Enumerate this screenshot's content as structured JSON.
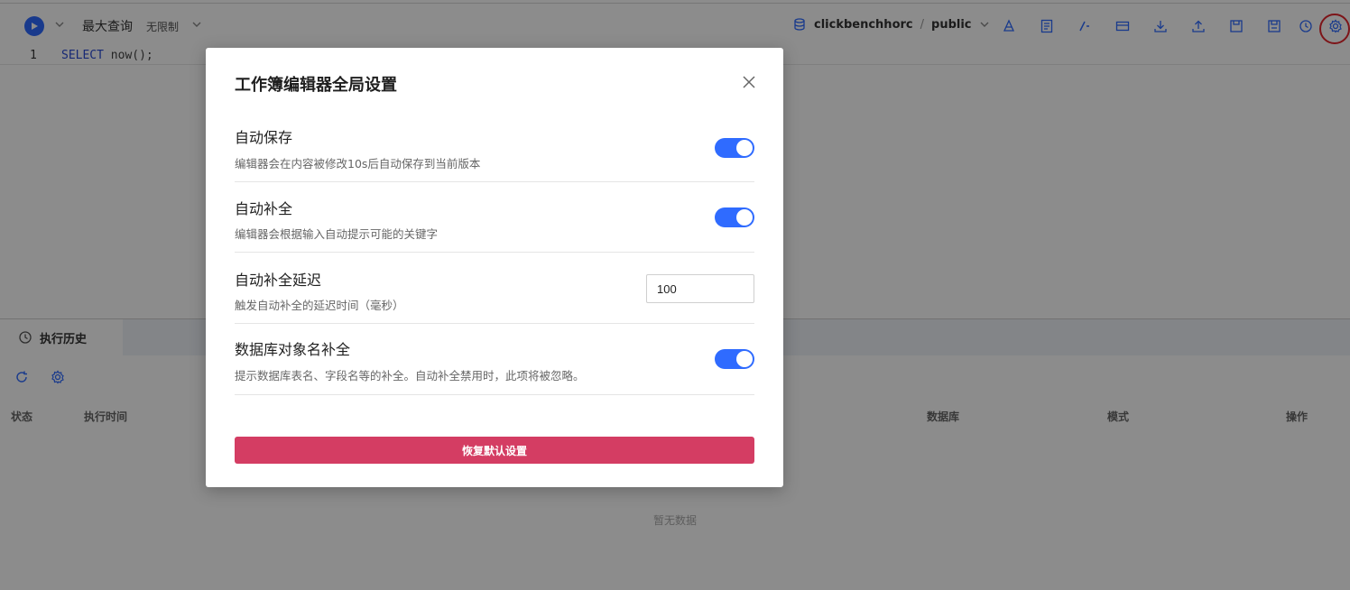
{
  "toolbar": {
    "max_query_label": "最大查询",
    "limit_value": "无限制",
    "database": "clickbenchhorc",
    "separator": "/",
    "schema": "public"
  },
  "editor": {
    "line_number": "1",
    "code_keyword": "SELECT",
    "code_rest": " now();"
  },
  "history": {
    "tab_label": "执行历史",
    "columns": {
      "status": "状态",
      "exec_time": "执行时间",
      "database": "数据库",
      "mode": "模式",
      "actions": "操作"
    },
    "empty_text": "暂无数据"
  },
  "modal": {
    "title": "工作簿编辑器全局设置",
    "settings": [
      {
        "title": "自动保存",
        "desc": "编辑器会在内容被修改10s后自动保存到当前版本",
        "enabled": true
      },
      {
        "title": "自动补全",
        "desc": "编辑器会根据输入自动提示可能的关键字",
        "enabled": true
      },
      {
        "title": "自动补全延迟",
        "desc": "触发自动补全的延迟时间（毫秒）",
        "value": "100"
      },
      {
        "title": "数据库对象名补全",
        "desc": "提示数据库表名、字段名等的补全。自动补全禁用时，此项将被忽略。",
        "enabled": true
      }
    ],
    "reset_label": "恢复默认设置"
  },
  "colors": {
    "accent": "#2f6bff",
    "reset_button": "#d43d63",
    "highlight_ring": "#e4262d"
  }
}
